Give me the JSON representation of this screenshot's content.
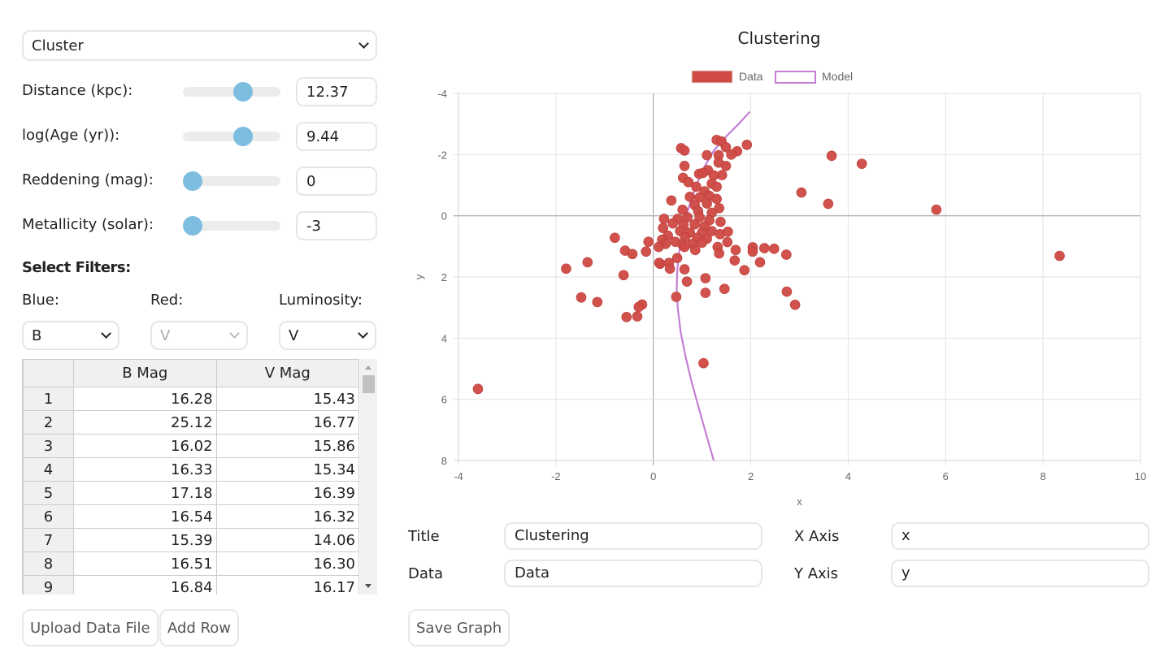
{
  "controls": {
    "preset_select": "Cluster",
    "params": [
      {
        "label": "Distance (kpc):",
        "value": "12.37",
        "slider_fraction": 0.65
      },
      {
        "label": "log(Age (yr)):",
        "value": "9.44",
        "slider_fraction": 0.65
      },
      {
        "label": "Reddening (mag):",
        "value": "0",
        "slider_fraction": 0.0
      },
      {
        "label": "Metallicity (solar):",
        "value": "-3",
        "slider_fraction": 0.0
      }
    ],
    "filters_title": "Select Filters:",
    "filters": [
      {
        "label": "Blue:",
        "value": "B",
        "disabled": false
      },
      {
        "label": "Red:",
        "value": "V",
        "disabled": true
      },
      {
        "label": "Luminosity:",
        "value": "V",
        "disabled": false
      }
    ]
  },
  "table": {
    "headers": [
      "",
      "B Mag",
      "V Mag"
    ],
    "rows": [
      [
        "1",
        "16.28",
        "15.43"
      ],
      [
        "2",
        "25.12",
        "16.77"
      ],
      [
        "3",
        "16.02",
        "15.86"
      ],
      [
        "4",
        "16.33",
        "15.34"
      ],
      [
        "5",
        "17.18",
        "16.39"
      ],
      [
        "6",
        "16.54",
        "16.32"
      ],
      [
        "7",
        "15.39",
        "14.06"
      ],
      [
        "8",
        "16.51",
        "16.30"
      ],
      [
        "9",
        "16.84",
        "16.17"
      ]
    ]
  },
  "buttons": {
    "upload": "Upload Data File",
    "add_row": "Add Row",
    "save_graph": "Save Graph"
  },
  "graph_form": {
    "title_label": "Title",
    "title_value": "Clustering",
    "data_label": "Data",
    "data_value": "Data",
    "xaxis_label": "X Axis",
    "xaxis_value": "x",
    "yaxis_label": "Y Axis",
    "yaxis_value": "y"
  },
  "colors": {
    "data": "#d04b46",
    "model": "#c47fd5",
    "slider_thumb": "#7dbde0"
  },
  "chart_data": {
    "type": "scatter",
    "title": "Clustering",
    "xlabel": "x",
    "ylabel": "y",
    "xlim": [
      -4,
      10
    ],
    "ylim": [
      -4,
      8
    ],
    "y_inverted": true,
    "x_ticks": [
      "-4",
      "-2",
      "0",
      "2",
      "4",
      "6",
      "8",
      "10"
    ],
    "y_ticks": [
      "-4",
      "-2",
      "0",
      "2",
      "4",
      "6",
      "8"
    ],
    "grid": true,
    "legend": {
      "placement": "top-center",
      "entries": [
        "Data",
        "Model"
      ]
    },
    "series": [
      {
        "name": "Data",
        "kind": "points",
        "points": [
          [
            0.57,
            -2.21
          ],
          [
            0.64,
            -2.13
          ],
          [
            1.3,
            -2.48
          ],
          [
            1.4,
            -2.43
          ],
          [
            1.49,
            -2.24
          ],
          [
            1.92,
            -2.32
          ],
          [
            1.72,
            -2.11
          ],
          [
            1.6,
            -2.0
          ],
          [
            1.1,
            -1.98
          ],
          [
            1.34,
            -1.98
          ],
          [
            0.64,
            -1.63
          ],
          [
            1.49,
            -1.63
          ],
          [
            1.34,
            -1.74
          ],
          [
            1.12,
            -1.49
          ],
          [
            1.41,
            -1.33
          ],
          [
            0.61,
            -1.24
          ],
          [
            1.24,
            -1.32
          ],
          [
            0.94,
            -1.37
          ],
          [
            1.02,
            -1.4
          ],
          [
            0.72,
            -1.1
          ],
          [
            1.2,
            -1.05
          ],
          [
            1.3,
            -0.95
          ],
          [
            0.88,
            -0.95
          ],
          [
            1.05,
            -0.8
          ],
          [
            0.75,
            -0.62
          ],
          [
            1.15,
            -0.65
          ],
          [
            0.95,
            -0.6
          ],
          [
            1.3,
            -0.55
          ],
          [
            0.37,
            -0.5
          ],
          [
            1.1,
            -0.4
          ],
          [
            0.85,
            -0.35
          ],
          [
            1.35,
            -0.25
          ],
          [
            0.6,
            -0.2
          ],
          [
            0.92,
            -0.15
          ],
          [
            1.2,
            -0.1
          ],
          [
            0.22,
            0.1
          ],
          [
            0.5,
            0.1
          ],
          [
            0.7,
            0.05
          ],
          [
            0.95,
            0.05
          ],
          [
            1.15,
            0.15
          ],
          [
            1.38,
            0.2
          ],
          [
            0.4,
            0.25
          ],
          [
            0.62,
            0.3
          ],
          [
            0.85,
            0.28
          ],
          [
            1.05,
            0.35
          ],
          [
            0.2,
            0.4
          ],
          [
            0.55,
            0.5
          ],
          [
            0.75,
            0.55
          ],
          [
            1.0,
            0.55
          ],
          [
            1.2,
            0.5
          ],
          [
            1.37,
            0.6
          ],
          [
            1.53,
            0.52
          ],
          [
            0.3,
            0.65
          ],
          [
            0.65,
            0.7
          ],
          [
            0.9,
            0.72
          ],
          [
            1.1,
            0.75
          ],
          [
            0.18,
            0.78
          ],
          [
            0.45,
            0.85
          ],
          [
            1.52,
            0.86
          ],
          [
            0.25,
            0.92
          ],
          [
            0.6,
            0.95
          ],
          [
            0.8,
            0.92
          ],
          [
            1.0,
            0.88
          ],
          [
            0.64,
            1.02
          ],
          [
            0.11,
            1.02
          ],
          [
            1.32,
            1.02
          ],
          [
            0.86,
            1.12
          ],
          [
            1.35,
            1.23
          ],
          [
            1.69,
            1.12
          ],
          [
            1.67,
            1.46
          ],
          [
            1.87,
            1.78
          ],
          [
            2.04,
            1.03
          ],
          [
            2.04,
            1.17
          ],
          [
            2.19,
            1.52
          ],
          [
            2.28,
            1.06
          ],
          [
            2.48,
            1.08
          ],
          [
            2.73,
            1.27
          ],
          [
            0.49,
            1.38
          ],
          [
            0.14,
            1.57
          ],
          [
            0.32,
            1.54
          ],
          [
            0.34,
            1.73
          ],
          [
            0.64,
            1.75
          ],
          [
            0.69,
            2.15
          ],
          [
            1.07,
            2.04
          ],
          [
            1.07,
            2.52
          ],
          [
            1.46,
            2.39
          ],
          [
            0.47,
            2.65
          ],
          [
            1.03,
            4.82
          ],
          [
            2.74,
            2.48
          ],
          [
            2.91,
            2.91
          ],
          [
            3.66,
            -1.96
          ],
          [
            4.28,
            -1.7
          ],
          [
            3.04,
            -0.76
          ],
          [
            3.59,
            -0.39
          ],
          [
            5.81,
            -0.2
          ],
          [
            8.34,
            1.31
          ],
          [
            -0.79,
            0.72
          ],
          [
            -1.35,
            1.52
          ],
          [
            -1.79,
            1.73
          ],
          [
            -0.58,
            1.14
          ],
          [
            -0.43,
            1.25
          ],
          [
            -0.61,
            1.94
          ],
          [
            -1.48,
            2.67
          ],
          [
            -1.15,
            2.82
          ],
          [
            -0.1,
            0.85
          ],
          [
            -0.15,
            1.17
          ],
          [
            -0.23,
            2.9
          ],
          [
            -0.3,
            2.98
          ],
          [
            -0.33,
            3.29
          ],
          [
            -0.55,
            3.31
          ],
          [
            -3.6,
            5.66
          ],
          [
            0.12,
            1.54
          ]
        ]
      },
      {
        "name": "Model",
        "kind": "line",
        "points": [
          [
            1.98,
            -3.4
          ],
          [
            1.75,
            -3.0
          ],
          [
            1.5,
            -2.6
          ],
          [
            1.25,
            -2.15
          ],
          [
            1.05,
            -1.6
          ],
          [
            0.88,
            -1.0
          ],
          [
            0.75,
            -0.4
          ],
          [
            0.65,
            0.2
          ],
          [
            0.58,
            0.7
          ],
          [
            0.52,
            1.3
          ],
          [
            0.49,
            1.8
          ],
          [
            0.48,
            2.4
          ],
          [
            0.5,
            3.0
          ],
          [
            0.56,
            3.8
          ],
          [
            0.66,
            4.6
          ],
          [
            0.78,
            5.4
          ],
          [
            0.92,
            6.2
          ],
          [
            1.06,
            7.0
          ],
          [
            1.24,
            8.0
          ]
        ]
      }
    ]
  }
}
